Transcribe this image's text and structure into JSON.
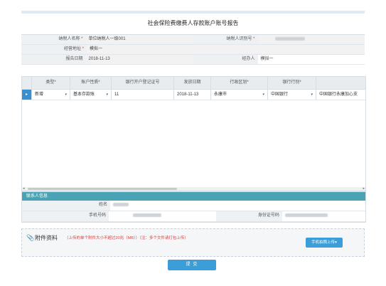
{
  "page_title": "社会保险费缴费人存款账户账号报告",
  "form": {
    "taxpayer_name_label": "纳税人名称",
    "taxpayer_name_value": "单位纳税人一级001",
    "taxpayer_id_label": "纳税人识别号",
    "address_label": "经营地址",
    "address_value": "模拟一",
    "report_date_label": "报告日期",
    "report_date_value": "2018-11-13",
    "handler_label": "经办人",
    "handler_value": "模拟一",
    "required_mark": "*"
  },
  "grid": {
    "columns": [
      "类型*",
      "账户性质*",
      "银行开户登记证号",
      "发放日期",
      "行政区划*",
      "银行行别*",
      ""
    ],
    "row": {
      "select_mark": "▸",
      "type": "新增",
      "account_nature": "基本存款账",
      "bank_reg_no": "11",
      "issue_date": "2018-11-13",
      "admin_region": "永康市",
      "bank_type": "中国银行",
      "bank_branch": "中国银行永康加心支"
    },
    "dropdown_arrow": "▾"
  },
  "contact": {
    "header": "联系人信息",
    "name_label": "姓名",
    "phone_label": "手机号码",
    "id_label": "身份证号码"
  },
  "attachment": {
    "title": "附件资料",
    "note": "（上传的单个附件大小不超过20兆（MB））（注：多个文件请打包上传）",
    "mobile_upload": "手机拍照上传▾"
  },
  "submit_label": "提 交"
}
